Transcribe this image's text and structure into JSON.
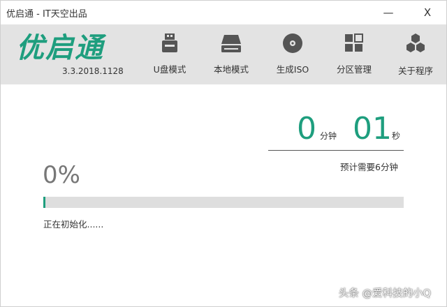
{
  "window": {
    "title": "优启通 - IT天空出品",
    "minimize_glyph": "—",
    "close_glyph": "X"
  },
  "brand": {
    "logo_text": "优启通",
    "version": "3.3.2018.1128",
    "accent_color": "#1e9e7e"
  },
  "toolbar": {
    "items": [
      {
        "label": "U盘模式",
        "icon": "usb-drive-icon"
      },
      {
        "label": "本地模式",
        "icon": "hard-drive-icon"
      },
      {
        "label": "生成ISO",
        "icon": "disc-icon"
      },
      {
        "label": "分区管理",
        "icon": "partition-grid-icon"
      },
      {
        "label": "关于程序",
        "icon": "about-hexagons-icon"
      }
    ]
  },
  "timer": {
    "minutes": "0",
    "minutes_unit": "分钟",
    "seconds": "01",
    "seconds_unit": "秒",
    "estimate": "预计需要6分钟"
  },
  "progress": {
    "percent_text": "0%",
    "fraction": 0,
    "status": "正在初始化......"
  },
  "watermark": {
    "text": "头条 @爱科技的小Q"
  }
}
